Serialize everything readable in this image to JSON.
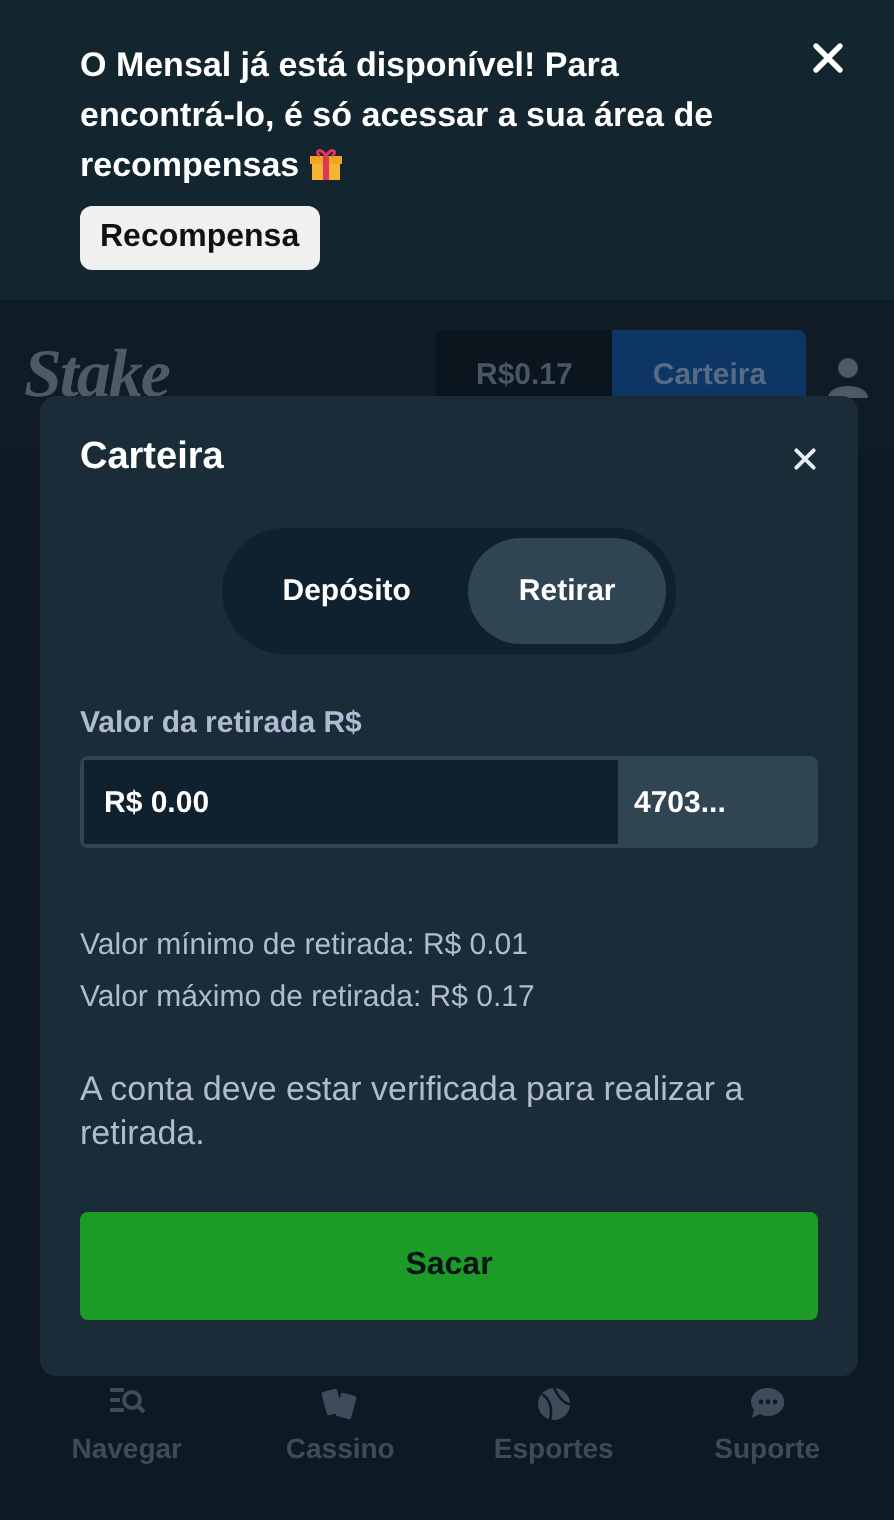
{
  "banner": {
    "message": "O Mensal já está disponível! Para encontrá-lo, é só acessar a sua área de recompensas",
    "button": "Recompensa"
  },
  "header": {
    "logo": "Stake",
    "balance": "R$0.17",
    "wallet_button": "Carteira"
  },
  "modal": {
    "title": "Carteira",
    "tabs": [
      {
        "label": "Depósito",
        "selected": false
      },
      {
        "label": "Retirar",
        "selected": true
      }
    ],
    "amount_label": "Valor da retirada R$",
    "amount_value": "R$ 0.00",
    "amount_suffix": "4703...",
    "limits": [
      "Valor mínimo de retirada: R$ 0.01",
      "Valor máximo de retirada: R$ 0.17"
    ],
    "notice": "A conta deve estar verificada para realizar a retirada.",
    "submit": "Sacar"
  },
  "nav": [
    {
      "kind": "browse",
      "label": "Navegar"
    },
    {
      "kind": "casino",
      "label": "Cassino"
    },
    {
      "kind": "sports",
      "label": "Esportes"
    },
    {
      "kind": "support",
      "label": "Suporte"
    }
  ]
}
